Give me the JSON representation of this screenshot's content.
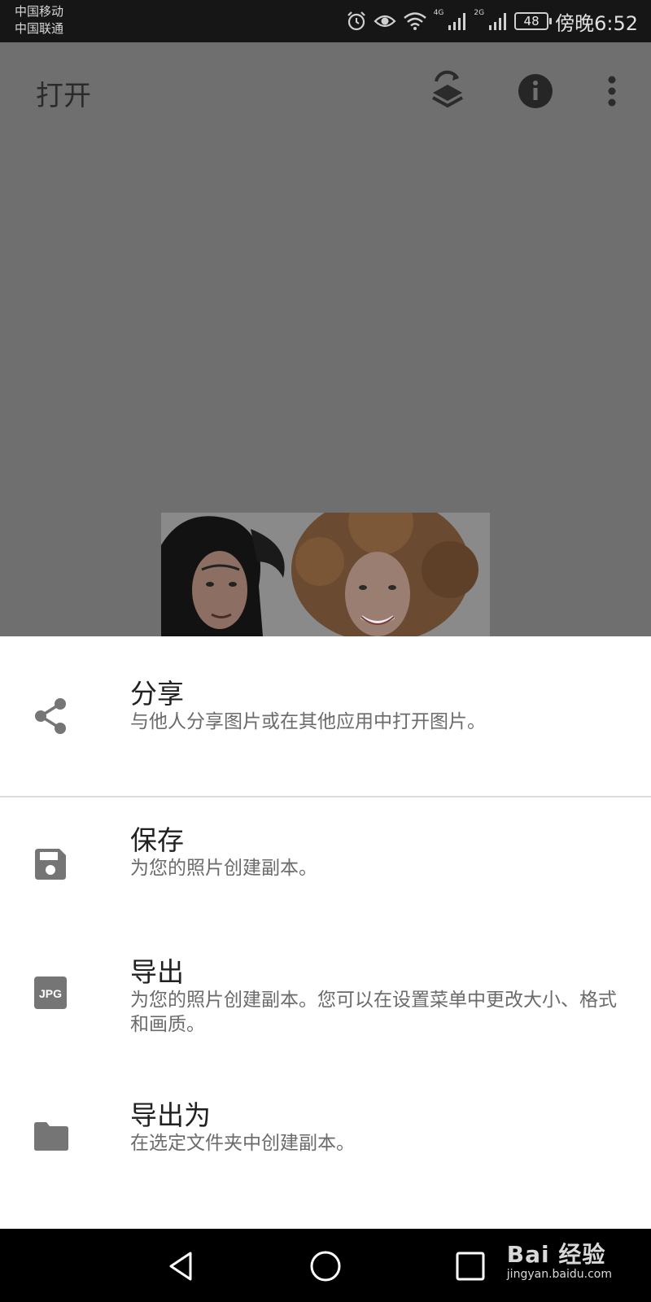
{
  "status_bar": {
    "carrier1": "中国移动",
    "carrier2": "中国联通",
    "signal1_label": "4G",
    "signal2_label": "2G",
    "battery": "48",
    "time": "傍晚6:52"
  },
  "toolbar": {
    "open_label": "打开",
    "icons": [
      "layers-refresh-icon",
      "info-icon",
      "more-vert-icon"
    ]
  },
  "sheet": {
    "share": {
      "title": "分享",
      "desc": "与他人分享图片或在其他应用中打开图片。",
      "icon": "share-icon"
    },
    "save": {
      "title": "保存",
      "desc": "为您的照片创建副本。",
      "icon": "save-icon"
    },
    "export": {
      "title": "导出",
      "desc": "为您的照片创建副本。您可以在设置菜单中更改大小、格式和画质。",
      "icon": "jpg-icon",
      "icon_text": "JPG"
    },
    "export_as": {
      "title": "导出为",
      "desc": "在选定文件夹中创建副本。",
      "icon": "folder-icon"
    }
  },
  "watermark": {
    "top": "Bai 经验",
    "bottom": "jingyan.baidu.com"
  },
  "colors": {
    "scrim": "#6f6f6f",
    "sheet": "#ffffff",
    "icon": "#757575",
    "status_bar": "#161616"
  }
}
